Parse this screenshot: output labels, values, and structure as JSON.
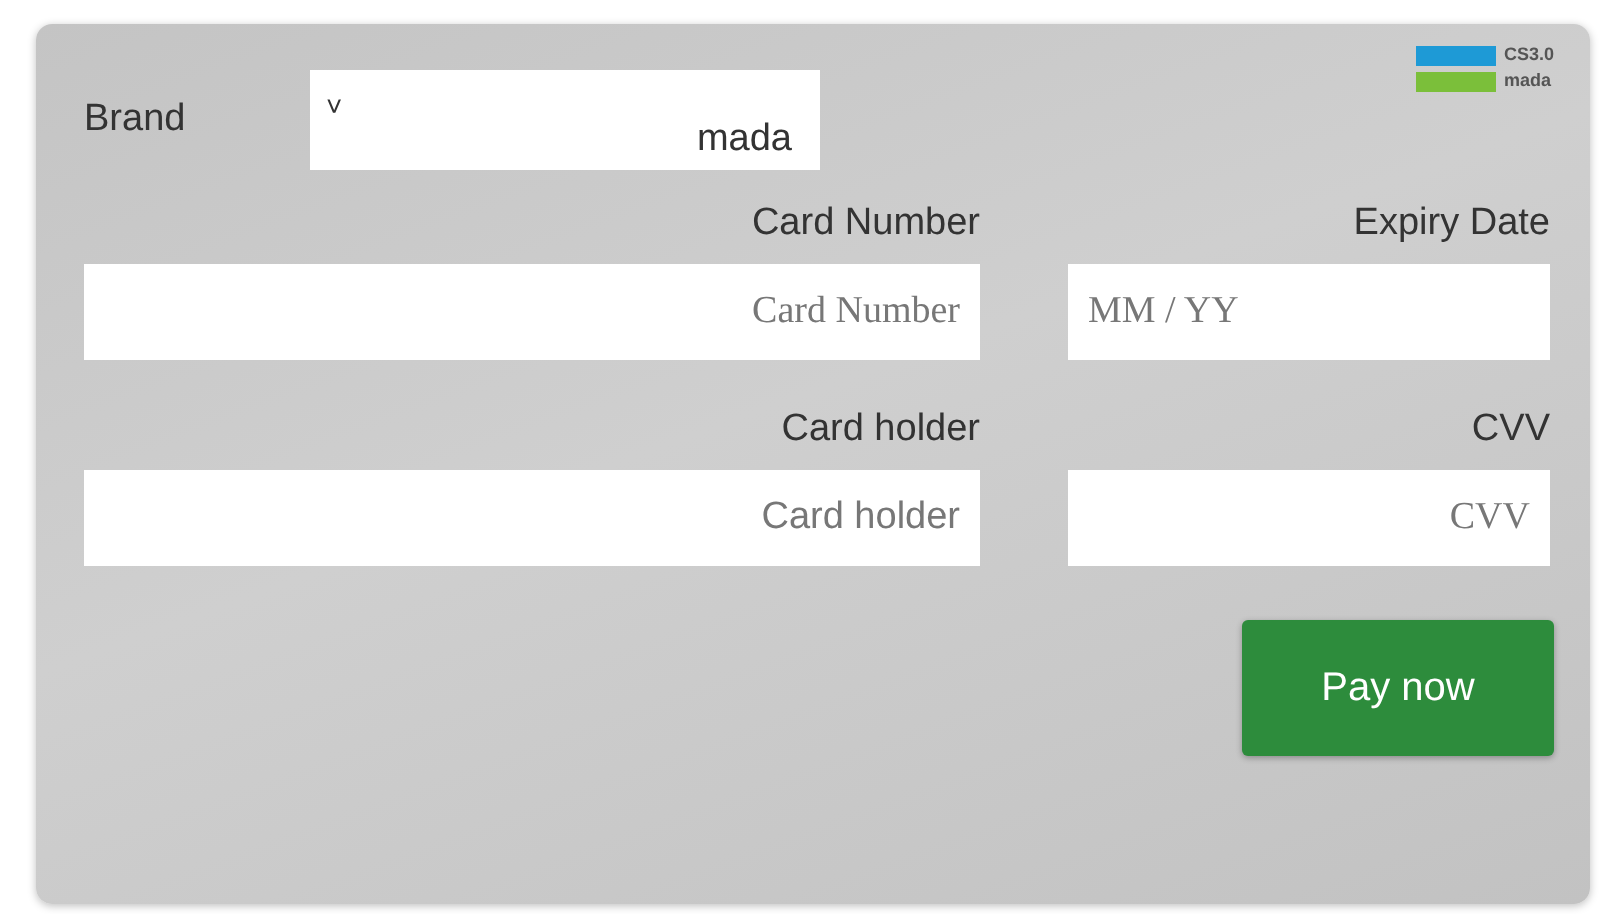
{
  "brand": {
    "label": "Brand",
    "value": "mada",
    "caret": "˅"
  },
  "logo": {
    "line_1": "CS3.0",
    "line_2": "mada"
  },
  "fields": [
    {
      "label": "Card Number",
      "placeholder": "Card Number"
    },
    {
      "label": "Expiry Date",
      "placeholder": "MM / YY"
    },
    {
      "label": "Card holder",
      "placeholder": "Card holder"
    },
    {
      "label": "CVV",
      "placeholder": "CVV"
    }
  ],
  "pay_button": "Pay now"
}
